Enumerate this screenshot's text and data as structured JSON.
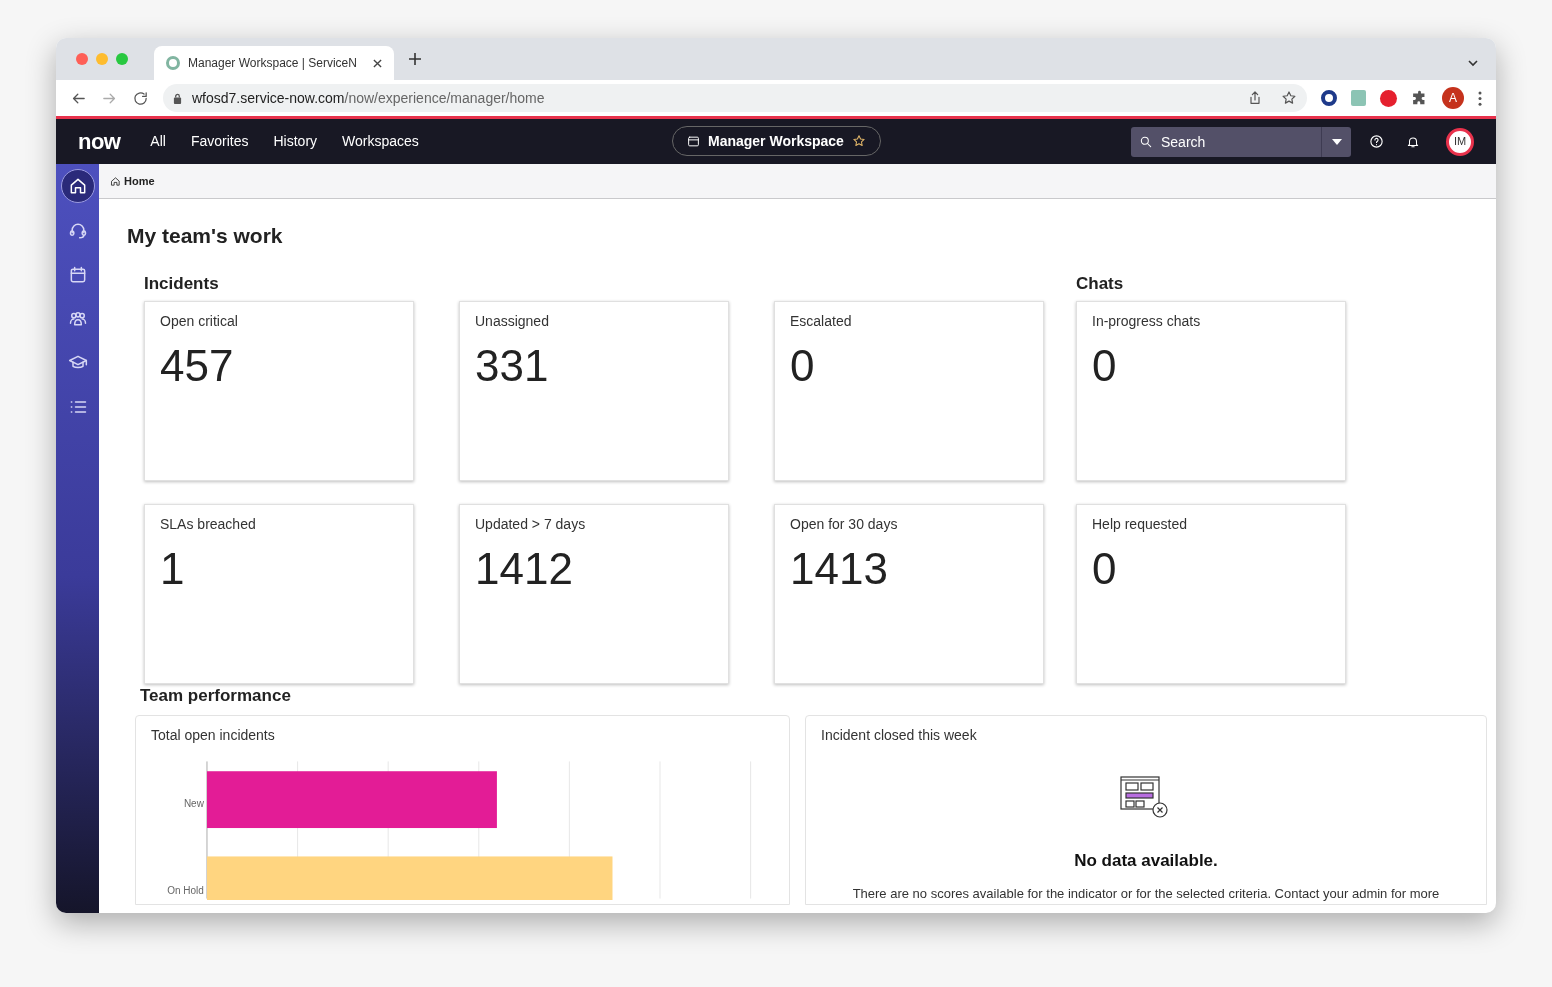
{
  "browser": {
    "tab_title": "Manager Workspace | ServiceN",
    "url_host": "wfosd7.service-now.com",
    "url_path": "/now/experience/manager/home",
    "profile": "A"
  },
  "navbar": {
    "logo": "now",
    "menu": [
      "All",
      "Favorites",
      "History",
      "Workspaces"
    ],
    "workspace": "Manager Workspace",
    "search": {
      "placeholder": "Search"
    },
    "avatar": "IM"
  },
  "sidebar": {
    "items": [
      {
        "kind": "home",
        "selected": true
      },
      {
        "kind": "headset",
        "selected": false
      },
      {
        "kind": "calendar",
        "selected": false
      },
      {
        "kind": "people",
        "selected": false
      },
      {
        "kind": "learning",
        "selected": false
      },
      {
        "kind": "list",
        "selected": false
      }
    ]
  },
  "breadcrumb": "Home",
  "page_title": "My team's work",
  "incidents": {
    "title": "Incidents",
    "cards": [
      {
        "label": "Open critical",
        "value": "457"
      },
      {
        "label": "Unassigned",
        "value": "331"
      },
      {
        "label": "Escalated",
        "value": "0"
      },
      {
        "label": "SLAs breached",
        "value": "1"
      },
      {
        "label": "Updated > 7 days",
        "value": "1412"
      },
      {
        "label": "Open for 30 days",
        "value": "1413"
      }
    ]
  },
  "chats": {
    "title": "Chats",
    "cards": [
      {
        "label": "In-progress chats",
        "value": "0"
      },
      {
        "label": "Help requested",
        "value": "0"
      }
    ]
  },
  "team_performance": {
    "title": "Team performance",
    "open_incidents": {
      "title": "Total open incidents",
      "bars": [
        {
          "label": "New",
          "color": "#e31c96"
        },
        {
          "label": "On Hold",
          "color": "#ffd580"
        }
      ]
    },
    "closed_this_week": {
      "title": "Incident closed this week",
      "empty_title": "No data available.",
      "empty_text": "There are no scores available for the indicator or for the selected criteria. Contact your admin for more"
    }
  }
}
